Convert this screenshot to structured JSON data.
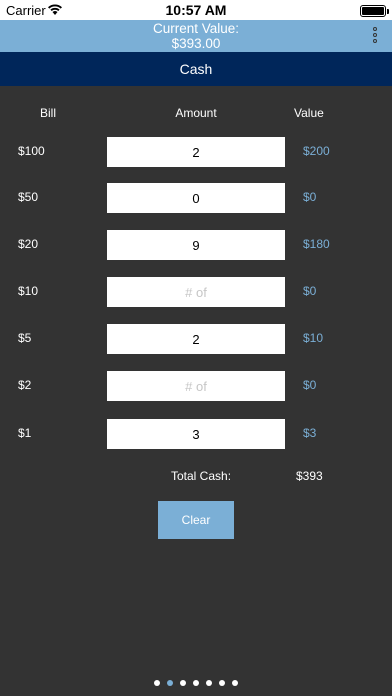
{
  "status_bar": {
    "carrier": "Carrier",
    "time": "10:57 AM"
  },
  "header": {
    "current_value_label": "Current Value:",
    "current_value": "$393.00"
  },
  "title": "Cash",
  "columns": {
    "bill": "Bill",
    "amount": "Amount",
    "value": "Value"
  },
  "rows": [
    {
      "bill": "$100",
      "amount": "2",
      "placeholder": "# of",
      "value": "$200"
    },
    {
      "bill": "$50",
      "amount": "0",
      "placeholder": "# of",
      "value": "$0"
    },
    {
      "bill": "$20",
      "amount": "9",
      "placeholder": "# of",
      "value": "$180"
    },
    {
      "bill": "$10",
      "amount": "",
      "placeholder": "# of",
      "value": "$0"
    },
    {
      "bill": "$5",
      "amount": "2",
      "placeholder": "# of",
      "value": "$10"
    },
    {
      "bill": "$2",
      "amount": "",
      "placeholder": "# of",
      "value": "$0"
    },
    {
      "bill": "$1",
      "amount": "3",
      "placeholder": "# of",
      "value": "$3"
    }
  ],
  "total": {
    "label": "Total Cash:",
    "value": "$393"
  },
  "clear_label": "Clear",
  "pager": {
    "count": 7,
    "active_index": 1
  },
  "colors": {
    "accent": "#7bafd6",
    "navy": "#00265a",
    "background": "#333333"
  },
  "icons": {
    "wifi": "wifi-icon",
    "battery": "battery-icon",
    "menu": "more-vertical-icon"
  }
}
